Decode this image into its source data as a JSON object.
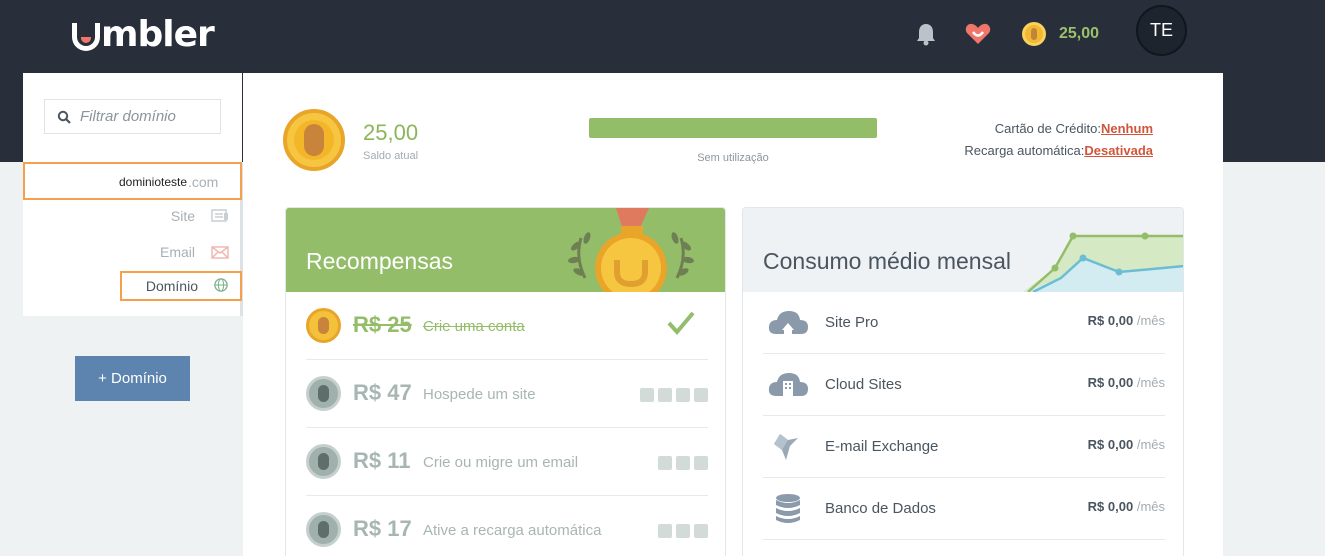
{
  "header": {
    "logo_text": "mbler",
    "balance": "25,00",
    "avatar_initials": "TE",
    "icons": [
      "bell-icon",
      "heart-icon",
      "coin-icon"
    ]
  },
  "sidebar": {
    "filter_placeholder": "Filtrar domínio",
    "domain": {
      "name": "dominioteste",
      "ext": ".com"
    },
    "items": [
      {
        "label": "Site",
        "icon": "site-icon"
      },
      {
        "label": "Email",
        "icon": "email-icon"
      },
      {
        "label": "Domínio",
        "icon": "globe-icon"
      }
    ],
    "add_button": "+ Domínio"
  },
  "summary": {
    "balance_value": "25,00",
    "balance_label": "Saldo atual",
    "usage_label": "Sem utilização",
    "usage_fraction": 0,
    "credit_card_label": "Cartão de Crédito:",
    "credit_card_value": "Nenhum",
    "auto_recharge_label": "Recarga automática:",
    "auto_recharge_value": "Desativada"
  },
  "rewards": {
    "title": "Recompensas",
    "items": [
      {
        "amount": "R$ 25",
        "desc": "Crie uma conta",
        "done": true
      },
      {
        "amount": "R$ 47",
        "desc": "Hospede um site",
        "done": false,
        "steps": 4
      },
      {
        "amount": "R$ 11",
        "desc": "Crie ou migre um email",
        "done": false,
        "steps": 3
      },
      {
        "amount": "R$ 17",
        "desc": "Ative a recarga automática",
        "done": false,
        "steps": 3
      }
    ]
  },
  "consumo": {
    "title": "Consumo médio mensal",
    "items": [
      {
        "name": "Site Pro",
        "price": "R$ 0,00",
        "unit": "/mês",
        "icon": "cloud-house-icon"
      },
      {
        "name": "Cloud Sites",
        "price": "R$ 0,00",
        "unit": "/mês",
        "icon": "cloud-building-icon"
      },
      {
        "name": "E-mail Exchange",
        "price": "R$ 0,00",
        "unit": "/mês",
        "icon": "exchange-icon"
      },
      {
        "name": "Banco de Dados",
        "price": "R$ 0,00",
        "unit": "/mês",
        "icon": "database-icon"
      }
    ]
  },
  "colors": {
    "header_bg": "#282f3b",
    "accent_green": "#93bd68",
    "button_blue": "#5c84ae",
    "link_red": "#d0553b",
    "highlight_orange": "#f4a04c"
  }
}
